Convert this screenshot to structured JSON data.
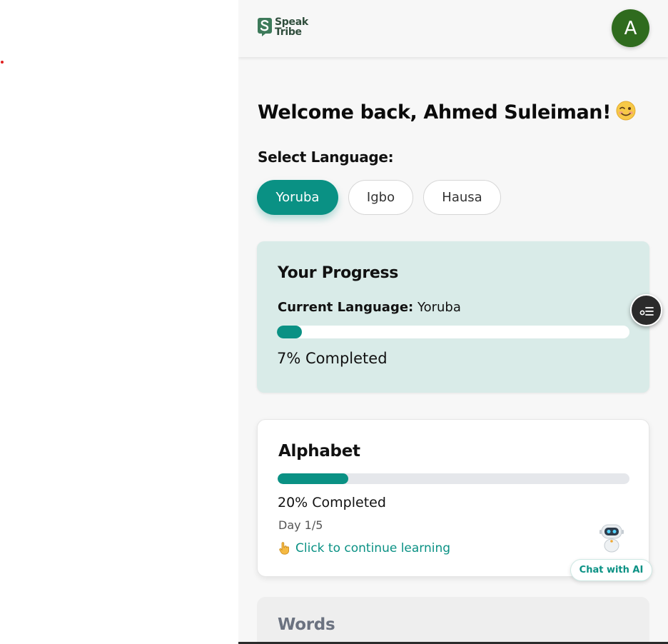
{
  "brand": {
    "line1": "Speak",
    "line2": "Tribe"
  },
  "user": {
    "avatar_initial": "A"
  },
  "welcome": {
    "text": "Welcome back, Ahmed Suleiman!",
    "emoji": "smiling-wink-face-icon"
  },
  "language_select": {
    "label": "Select Language:",
    "options": [
      "Yoruba",
      "Igbo",
      "Hausa"
    ],
    "selected": "Yoruba"
  },
  "progress": {
    "title": "Your Progress",
    "current_language_label": "Current Language:",
    "current_language": "Yoruba",
    "percent": 7,
    "percent_text": "7% Completed"
  },
  "lessons": [
    {
      "title": "Alphabet",
      "percent": 20,
      "percent_text": "20% Completed",
      "day_text": "Day 1/5",
      "cta": "Click to continue learning",
      "cta_icon": "pointing-hand-icon"
    },
    {
      "title": "Words"
    }
  ],
  "chat": {
    "label": "Chat with AI",
    "icon": "robot-icon"
  },
  "colors": {
    "accent": "#0a9184",
    "avatar": "#2f6b1e",
    "progress_card": "#d9ebe8",
    "logo": "#2f4d3c"
  }
}
